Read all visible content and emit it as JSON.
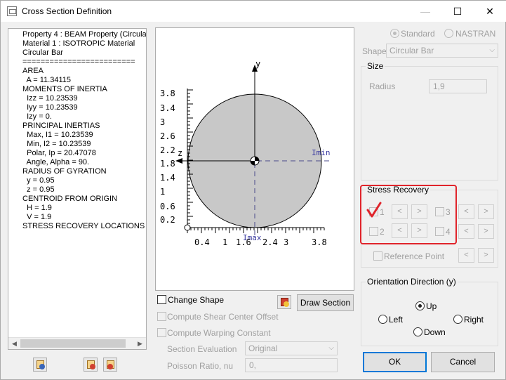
{
  "window": {
    "title": "Cross Section Definition",
    "minimize": "—",
    "maximize": "☐",
    "close": "✕"
  },
  "info": {
    "lines": [
      "Property 4 : BEAM Property (Circula",
      "Material 1 : ISOTROPIC Material",
      "Circular Bar",
      "=========================",
      "AREA",
      "  A = 11.34115",
      "MOMENTS OF INERTIA",
      "  Izz = 10.23539",
      "  Iyy = 10.23539",
      "  Izy = 0.",
      "PRINCIPAL INERTIAS",
      "  Max, I1 = 10.23539",
      "  Min, I2 = 10.23539",
      "  Polar, Ip = 20.47078",
      "  Angle, Alpha = 90.",
      "RADIUS OF GYRATION",
      "  y = 0.95",
      "  z = 0.95",
      "CENTROID FROM ORIGIN",
      "  H = 1.9",
      "  V = 1.9",
      "STRESS RECOVERY LOCATIONS"
    ],
    "scroll_left": "◀",
    "scroll_right": "▶"
  },
  "drawing": {
    "y_axis_label": "y",
    "z_axis_label": "z",
    "imin_label": "Imin",
    "imax_label": "Imax",
    "y_ticks": [
      "3.8",
      "3.4",
      "3",
      "2.6",
      "2.2",
      "1.8",
      "1.4",
      "1",
      "0.6",
      "0.2"
    ],
    "x_ticks": [
      "0.4",
      "1",
      "1.6",
      "2.4",
      "3",
      "3.8"
    ],
    "circle_fill": "#c8c8c8"
  },
  "controls": {
    "change_shape": "Change Shape",
    "draw_section": "Draw Section",
    "compute_shear": "Compute Shear Center Offset",
    "compute_warping": "Compute Warping Constant",
    "section_eval_label": "Section Evaluation",
    "section_eval_value": "Original",
    "poisson_label": "Poisson Ratio, nu",
    "poisson_value": "0,"
  },
  "shape": {
    "standard": "Standard",
    "nastran": "NASTRAN",
    "shape_label": "Shape",
    "shape_value": "Circular Bar"
  },
  "size": {
    "title": "Size",
    "radius_label": "Radius",
    "radius_value": "1,9"
  },
  "stress": {
    "title": "Stress Recovery",
    "p1": "1",
    "p2": "2",
    "p3": "3",
    "p4": "4",
    "prev": "<",
    "next": ">",
    "reference_point": "Reference Point",
    "check_color": "#e0242b"
  },
  "orientation": {
    "title": "Orientation Direction (y)",
    "up": "Up",
    "left": "Left",
    "right": "Right",
    "down": "Down"
  },
  "buttons": {
    "ok": "OK",
    "cancel": "Cancel"
  }
}
